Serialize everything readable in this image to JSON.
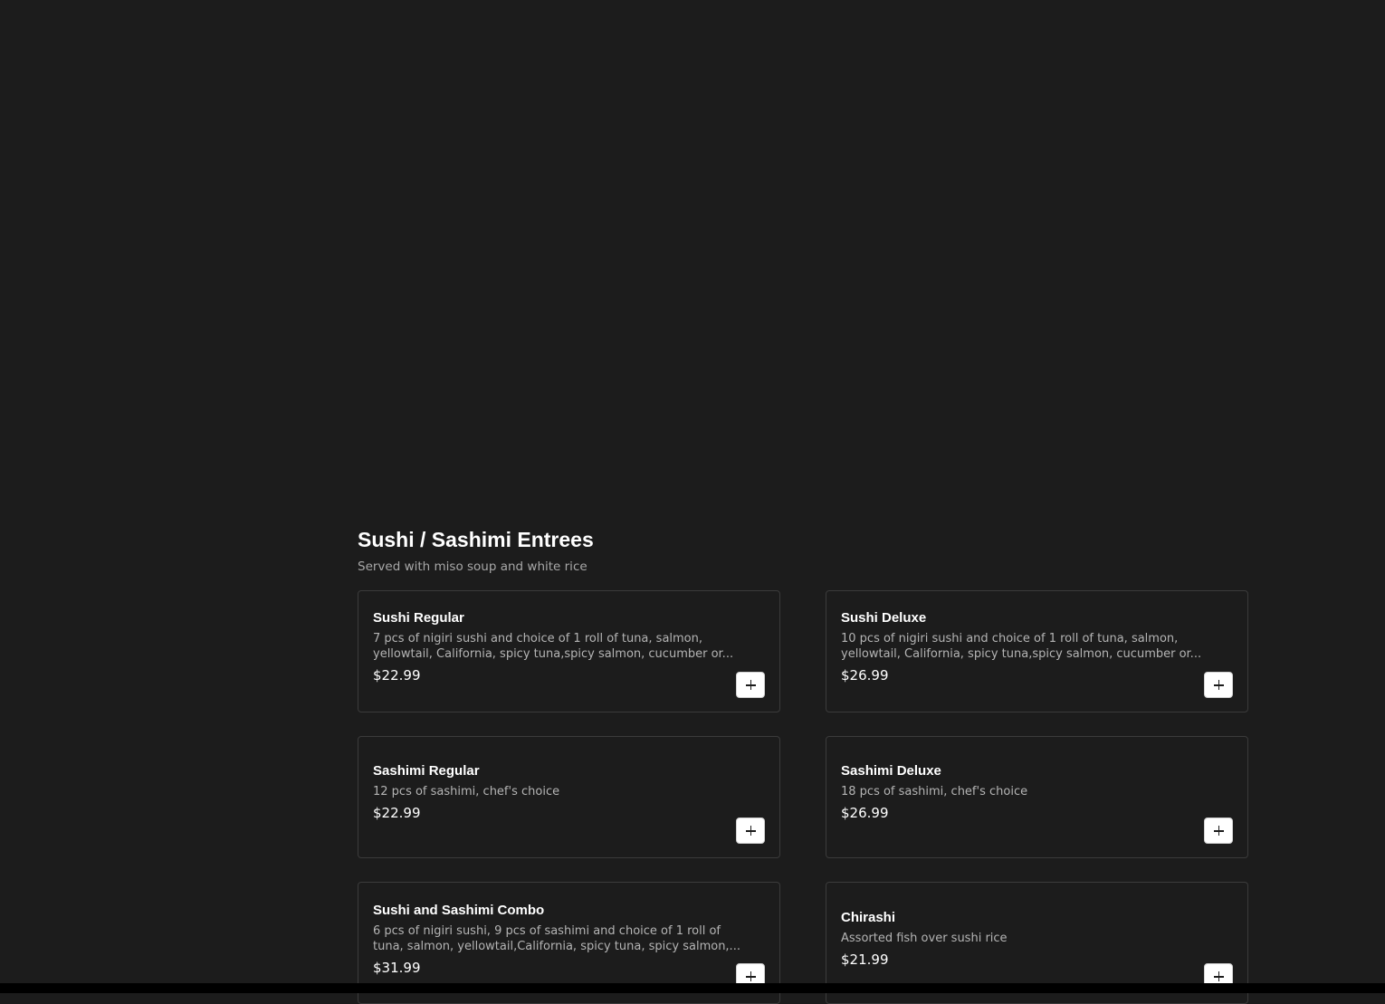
{
  "section": {
    "title": "Sushi / Sashimi Entrees",
    "subtitle": "Served with miso soup and white rice"
  },
  "items": [
    {
      "name": "Sushi Regular",
      "description": "7 pcs of nigiri sushi and choice of 1 roll of tuna, salmon, yellowtail, California, spicy tuna,spicy salmon, cucumber or...",
      "price": "$22.99"
    },
    {
      "name": "Sushi Deluxe",
      "description": "10 pcs of nigiri sushi and choice of 1 roll of tuna, salmon, yellowtail, California, spicy tuna,spicy salmon, cucumber or...",
      "price": "$26.99"
    },
    {
      "name": "Sashimi Regular",
      "description": "12 pcs of sashimi, chef's choice",
      "price": "$22.99"
    },
    {
      "name": "Sashimi Deluxe",
      "description": "18 pcs of sashimi, chef's choice",
      "price": "$26.99"
    },
    {
      "name": "Sushi and Sashimi Combo",
      "description": "6 pcs of nigiri sushi, 9 pcs of sashimi and choice of 1 roll of tuna, salmon, yellowtail,California, spicy tuna, spicy salmon,...",
      "price": "$31.99"
    },
    {
      "name": "Chirashi",
      "description": "Assorted fish over sushi rice",
      "price": "$21.99"
    }
  ],
  "add_button_icon": "plus-icon",
  "colors": {
    "background": "#1c1c1c",
    "card_border": "#3b3b3b",
    "button_bg": "#ffffff",
    "text_primary": "#ffffff",
    "text_secondary": "#b4b4b4"
  }
}
